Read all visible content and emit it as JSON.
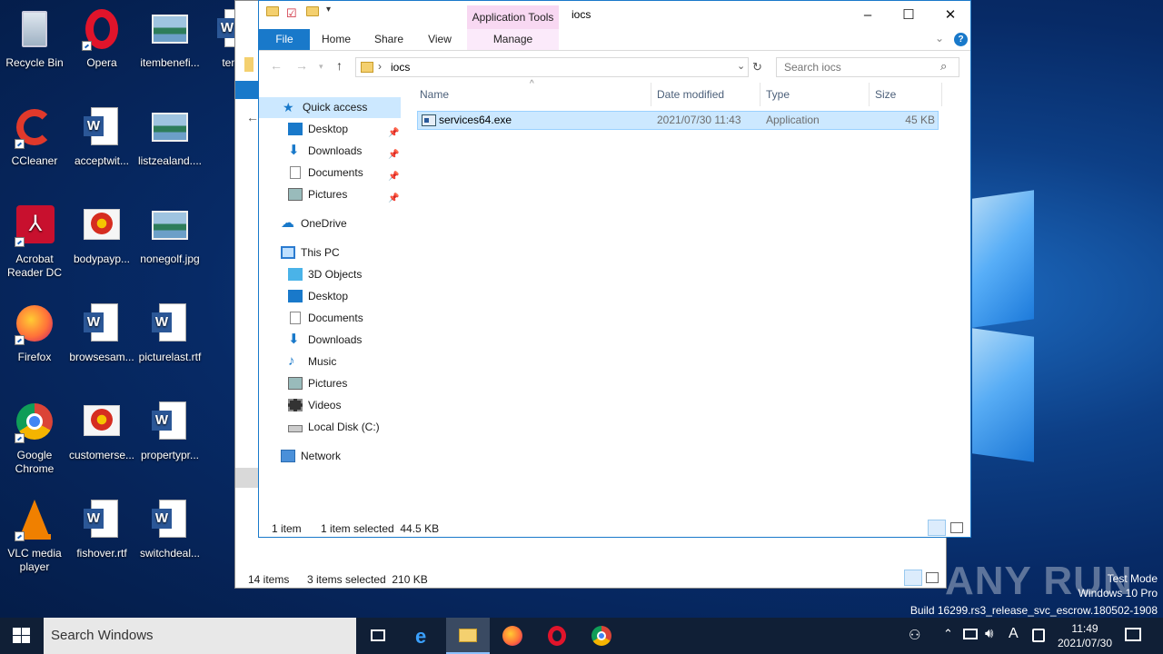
{
  "desktop": {
    "icons": [
      {
        "label": "Recycle Bin"
      },
      {
        "label": "Opera"
      },
      {
        "label": "itembenefi..."
      },
      {
        "label": "tench"
      },
      {
        "label": "CCleaner"
      },
      {
        "label": "acceptwit..."
      },
      {
        "label": "listzealand...."
      },
      {
        "label": "Acrobat Reader DC"
      },
      {
        "label": "bodypayp..."
      },
      {
        "label": "nonegolf.jpg"
      },
      {
        "label": "Firefox"
      },
      {
        "label": "browsesam..."
      },
      {
        "label": "picturelast.rtf"
      },
      {
        "label": "Google Chrome"
      },
      {
        "label": "customerse..."
      },
      {
        "label": "propertypr..."
      },
      {
        "label": "VLC media player"
      },
      {
        "label": "fishover.rtf"
      },
      {
        "label": "switchdeal..."
      }
    ]
  },
  "back_window": {
    "status_items": "14 items",
    "status_selected": "3 items selected  210 KB"
  },
  "explorer": {
    "title": "iocs",
    "app_tools": "Application Tools",
    "tabs": {
      "file": "File",
      "home": "Home",
      "share": "Share",
      "view": "View",
      "manage": "Manage"
    },
    "address": {
      "crumb": "iocs"
    },
    "search_placeholder": "Search iocs",
    "nav": {
      "quick_access": "Quick access",
      "qa_desktop": "Desktop",
      "qa_downloads": "Downloads",
      "qa_documents": "Documents",
      "qa_pictures": "Pictures",
      "onedrive": "OneDrive",
      "this_pc": "This PC",
      "objects3d": "3D Objects",
      "desktop": "Desktop",
      "documents": "Documents",
      "downloads": "Downloads",
      "music": "Music",
      "pictures": "Pictures",
      "videos": "Videos",
      "local_disk": "Local Disk (C:)",
      "network": "Network"
    },
    "columns": {
      "name": "Name",
      "date": "Date modified",
      "type": "Type",
      "size": "Size"
    },
    "files": [
      {
        "name": "services64.exe",
        "date": "2021/07/30 11:43",
        "type": "Application",
        "size": "45 KB"
      }
    ],
    "status_items": "1 item",
    "status_selected": "1 item selected  44.5 KB"
  },
  "watermark": {
    "brand": "ANY RUN",
    "test_mode": "Test Mode",
    "edition": "Windows 10 Pro",
    "build": "Build 16299.rs3_release_svc_escrow.180502-1908"
  },
  "taskbar": {
    "search": "Search Windows",
    "time": "11:49",
    "date": "2021/07/30",
    "ime": "A"
  }
}
